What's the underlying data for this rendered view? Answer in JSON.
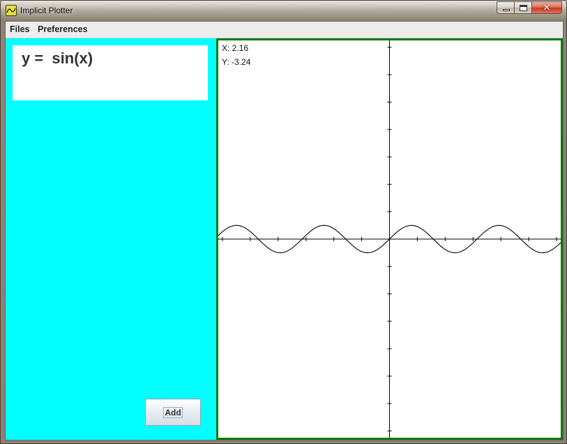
{
  "window": {
    "title": "Implicit Plotter",
    "close_symbol": "✕",
    "controls": [
      "minimize",
      "maximize",
      "close"
    ]
  },
  "menu": {
    "items": [
      {
        "label": "Files"
      },
      {
        "label": "Preferences"
      }
    ]
  },
  "equation_panel": {
    "equation": "y =  sin(x)",
    "add_label": "Add",
    "background": "#00ffff"
  },
  "plot": {
    "coords": {
      "x_label": "X: 2.16",
      "y_label": "Y: -3.24"
    },
    "border_color": "#0b7a0b",
    "function": "sin(x)",
    "x_range": [
      -12.3,
      12.3
    ],
    "y_range": [
      -14.5,
      14.5
    ],
    "tick_step": 2,
    "curve_color": "#000000"
  },
  "icons": {
    "app": "plot-app-icon",
    "minimize": "minimize-icon",
    "maximize": "maximize-icon",
    "close": "close-icon"
  }
}
